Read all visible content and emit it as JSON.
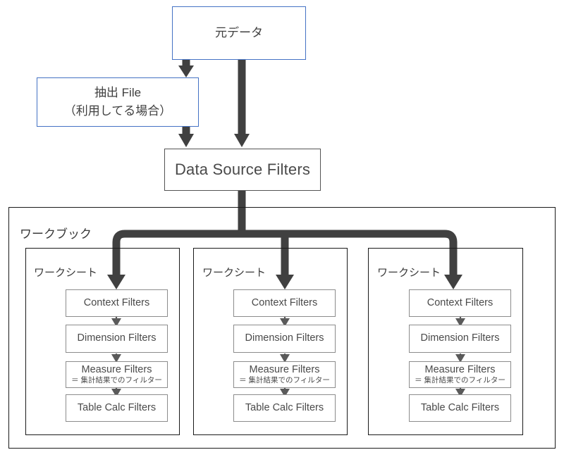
{
  "diagram": {
    "title_nodes": {
      "source": {
        "label": "元データ"
      },
      "extract": {
        "line1": "抽出 File",
        "line2": "（利用してる場合）"
      },
      "data_source_filters": {
        "label": "Data Source Filters"
      }
    },
    "workbook": {
      "label": "ワークブック"
    },
    "worksheets": [
      {
        "label": "ワークシート",
        "filters": [
          {
            "title": "Context Filters",
            "sub": ""
          },
          {
            "title": "Dimension Filters",
            "sub": ""
          },
          {
            "title": "Measure Filters",
            "sub": "＝ 集計結果でのフィルター"
          },
          {
            "title": "Table Calc Filters",
            "sub": ""
          }
        ]
      },
      {
        "label": "ワークシート",
        "filters": [
          {
            "title": "Context Filters",
            "sub": ""
          },
          {
            "title": "Dimension Filters",
            "sub": ""
          },
          {
            "title": "Measure Filters",
            "sub": "＝ 集計結果でのフィルター"
          },
          {
            "title": "Table Calc Filters",
            "sub": ""
          }
        ]
      },
      {
        "label": "ワークシート",
        "filters": [
          {
            "title": "Context Filters",
            "sub": ""
          },
          {
            "title": "Dimension Filters",
            "sub": ""
          },
          {
            "title": "Measure Filters",
            "sub": "＝ 集計結果でのフィルター"
          },
          {
            "title": "Table Calc Filters",
            "sub": ""
          }
        ]
      }
    ],
    "colors": {
      "source_border": "#4472c4",
      "primary_border": "#545454",
      "frame_border": "#1a1a1a",
      "filter_border": "#8c8c8c",
      "arrow": "#404040",
      "thin_arrow": "#5a5a5a",
      "background": "#ffffff"
    }
  }
}
